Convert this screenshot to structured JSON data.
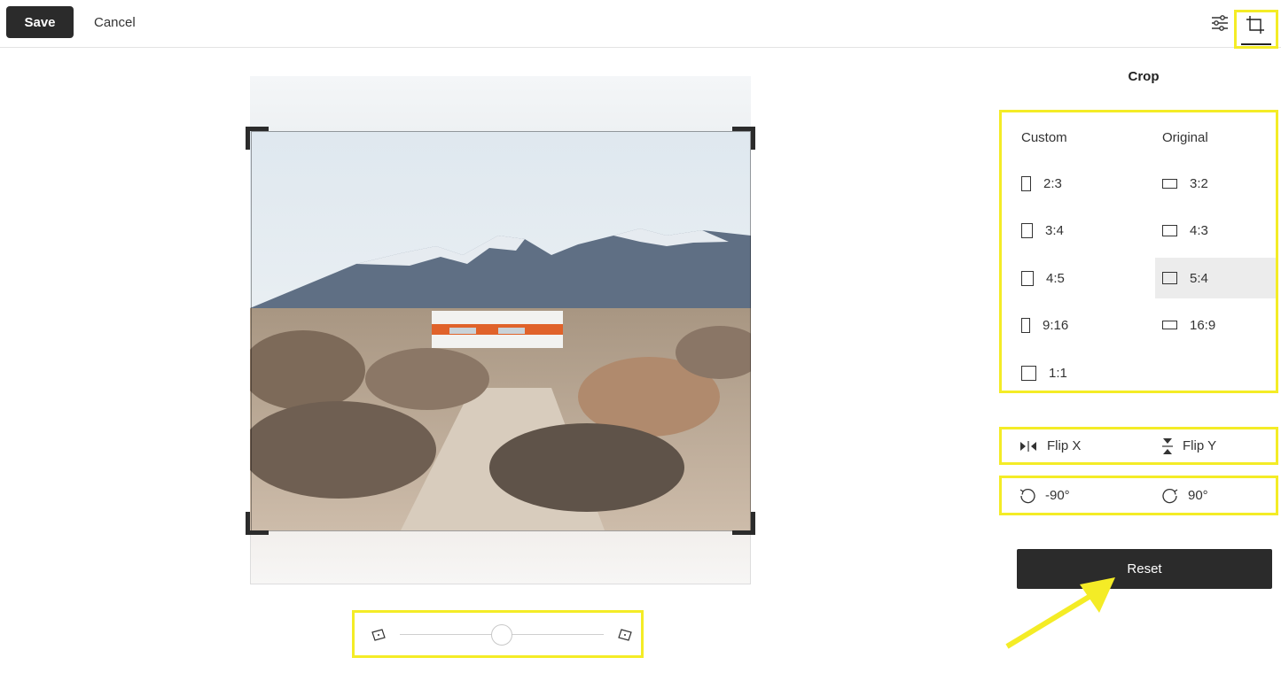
{
  "header": {
    "save_label": "Save",
    "cancel_label": "Cancel",
    "adjust_icon": "sliders-icon",
    "crop_icon": "crop-icon"
  },
  "panel": {
    "title": "Crop",
    "ratios_left": [
      {
        "label": "Custom",
        "shape": "none"
      },
      {
        "label": "2:3",
        "shape": "portrait"
      },
      {
        "label": "3:4",
        "shape": "portrait"
      },
      {
        "label": "4:5",
        "shape": "portrait"
      },
      {
        "label": "9:16",
        "shape": "portrait"
      },
      {
        "label": "1:1",
        "shape": "square"
      }
    ],
    "ratios_right": [
      {
        "label": "Original",
        "shape": "none"
      },
      {
        "label": "3:2",
        "shape": "landscape"
      },
      {
        "label": "4:3",
        "shape": "landscape"
      },
      {
        "label": "5:4",
        "shape": "landscape",
        "selected": true
      },
      {
        "label": "16:9",
        "shape": "landscape"
      }
    ],
    "flip_x_label": "Flip X",
    "flip_y_label": "Flip Y",
    "rotate_left_label": "-90°",
    "rotate_right_label": "90°",
    "reset_label": "Reset"
  },
  "rotation": {
    "value_fraction": 0.5
  },
  "colors": {
    "highlight": "#f4ec26",
    "dark": "#2b2b2b",
    "selected_bg": "#ececec"
  }
}
